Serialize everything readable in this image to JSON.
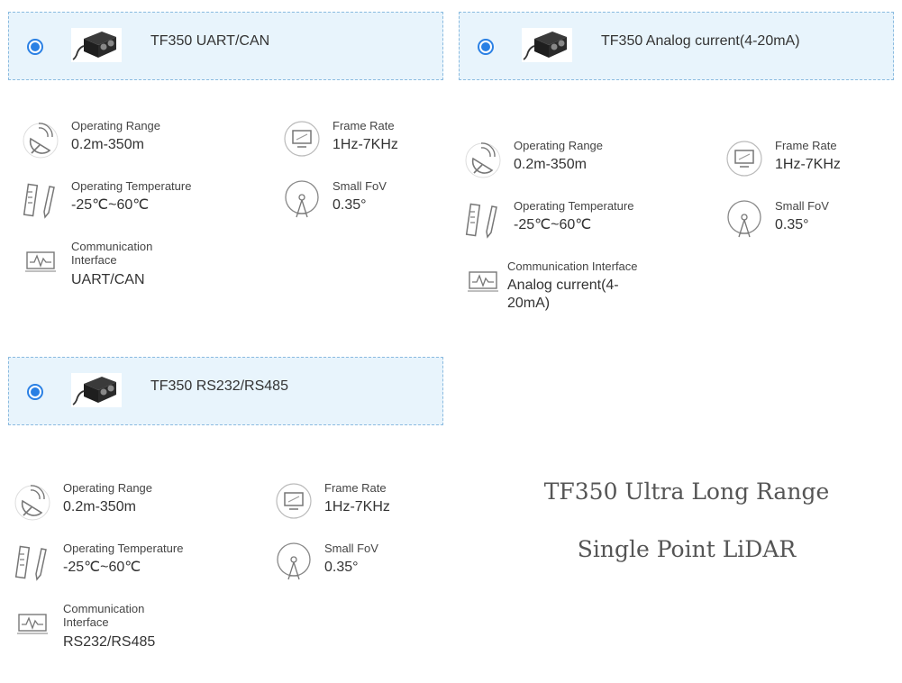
{
  "labels": {
    "range": "Operating Range",
    "frame": "Frame Rate",
    "temp": "Operating Temperature",
    "fov": "Small FoV",
    "comm": "Communication Interface",
    "comm_split_1": "Communication",
    "comm_split_2": "Interface"
  },
  "products": [
    {
      "name": "TF350 UART/CAN",
      "selected": true,
      "range": "0.2m-350m",
      "frame": "1Hz-7KHz",
      "temp": "-25℃~60℃",
      "fov": "0.35°",
      "comm": "UART/CAN"
    },
    {
      "name": "TF350 Analog current(4-20mA)",
      "selected": true,
      "range": "0.2m-350m",
      "frame": "1Hz-7KHz",
      "temp": "-25℃~60℃",
      "fov": "0.35°",
      "comm_1": "Analog current(4-",
      "comm_2": "20mA)"
    },
    {
      "name": "TF350 RS232/RS485",
      "selected": true,
      "range": "0.2m-350m",
      "frame": "1Hz-7KHz",
      "temp": "-25℃~60℃",
      "fov": "0.35°",
      "comm": "RS232/RS485"
    }
  ],
  "headline": {
    "line1": "TF350 Ultra Long Range",
    "line2": "Single Point LiDAR"
  },
  "colors": {
    "card_bg": "#e8f4fc",
    "card_border": "#8bbbe0",
    "radio": "#2a80e4"
  }
}
